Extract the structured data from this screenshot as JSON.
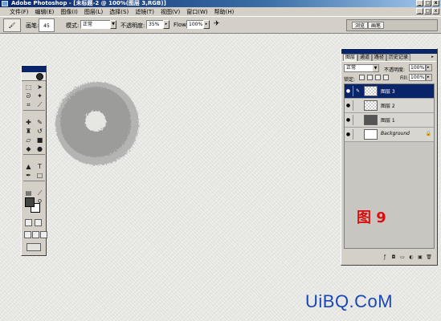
{
  "titlebar": {
    "title": "Adobe Photoshop - [未标题-2 @ 100%(图层 3,RGB)]",
    "controls": [
      "_",
      "□",
      "x"
    ]
  },
  "menubar": {
    "items": [
      "文件(F)",
      "编辑(E)",
      "图像(I)",
      "图层(L)",
      "选择(S)",
      "滤镜(T)",
      "视图(V)",
      "窗口(W)",
      "帮助(H)"
    ],
    "doc_controls": [
      "_",
      "□",
      "x"
    ]
  },
  "optionsbar": {
    "brush_label": "画笔:",
    "brush_size": "45",
    "mode_label": "模式:",
    "mode_value": "正常",
    "opacity_label": "不透明度:",
    "opacity_value": "35%",
    "flow_label": "Flow:",
    "flow_value": "100%",
    "palette_well_tabs": [
      "浏览",
      "画笔"
    ]
  },
  "layers_panel": {
    "tabs": [
      "图层",
      "通道",
      "路径",
      "历史记录"
    ],
    "blend_mode": "正常",
    "opacity_label": "不透明度:",
    "opacity_value": "100%",
    "lock_label": "锁定:",
    "fill_label": "Fill:",
    "fill_value": "100%",
    "layers": [
      {
        "name": "图层 3",
        "selected": true,
        "thumb": "checker"
      },
      {
        "name": "图层 2",
        "selected": false,
        "thumb": "checker"
      },
      {
        "name": "图层 1",
        "selected": false,
        "thumb": "dark"
      },
      {
        "name": "Background",
        "selected": false,
        "thumb": "white",
        "locked": true
      }
    ]
  },
  "figure_label": "图 9",
  "watermark": "UiBQ.CoM",
  "colors": {
    "title_blue": "#0a246a",
    "ui_gray": "#d4d0c8",
    "foreground": "#444444",
    "background": "#ffffff",
    "figure_red": "#d81010",
    "watermark_blue": "#1848b8"
  }
}
